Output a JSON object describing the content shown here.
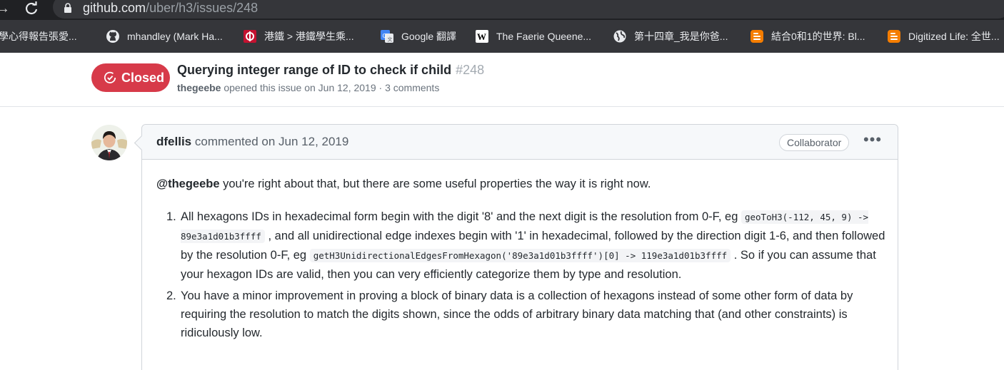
{
  "browser": {
    "url_host": "github.com",
    "url_path": "/uber/h3/issues/248",
    "bookmarks": [
      {
        "label": "學心得報告張愛...",
        "icon": "none"
      },
      {
        "label": "mhandley (Mark Ha...",
        "icon": "github-icon"
      },
      {
        "label": "港鐵 > 港鐵學生乘...",
        "icon": "mtr-icon"
      },
      {
        "label": "Google 翻譯",
        "icon": "google-translate-icon"
      },
      {
        "label": "The Faerie Queene...",
        "icon": "wikipedia-icon"
      },
      {
        "label": "第十四章_我是你爸...",
        "icon": "globe-icon"
      },
      {
        "label": "結合0和1的世界: Bl...",
        "icon": "blogger-icon"
      },
      {
        "label": "Digitized Life: 全世...",
        "icon": "blogger-icon"
      }
    ]
  },
  "issue": {
    "state": "Closed",
    "state_color": "#d73a49",
    "title": "Querying integer range of ID to check if child",
    "number": "#248",
    "author": "thegeebe",
    "meta_rest": "opened this issue on Jun 12, 2019 · 3 comments"
  },
  "comment": {
    "author": "dfellis",
    "timestamp": "commented on Jun 12, 2019",
    "role_badge": "Collaborator",
    "more_options": "•••",
    "mention": "@thegeebe",
    "intro_rest": " you're right about that, but there are some useful properties the way it is right now.",
    "item1": {
      "num": "1.",
      "t1": "All hexagons IDs in hexadecimal form begin with the digit '8' and the next digit is the resolution from 0-F, eg ",
      "c1": "geoToH3(-112, 45, 9) -> 89e3a1d01b3ffff",
      "t2": " , and all unidirectional edge indexes begin with '1' in hexadecimal, followed by the direction digit 1-6, and then followed by the resolution 0-F, eg ",
      "c2": "getH3UnidirectionalEdgesFromHexagon('89e3a1d01b3ffff')[0] -> 119e3a1d01b3ffff",
      "t3": " . So if you can assume that your hexagon IDs are valid, then you can very efficiently categorize them by type and resolution."
    },
    "item2": {
      "num": "2.",
      "text": "You have a minor improvement in proving a block of binary data is a collection of hexagons instead of some other form of data by requiring the resolution to match the digits shown, since the odds of arbitrary binary data matching that (and other constraints) is ridiculously low."
    }
  },
  "colors": {
    "chrome_dark": "#202124",
    "bookmark_bar": "#35363a",
    "link_muted": "#6a737d"
  }
}
